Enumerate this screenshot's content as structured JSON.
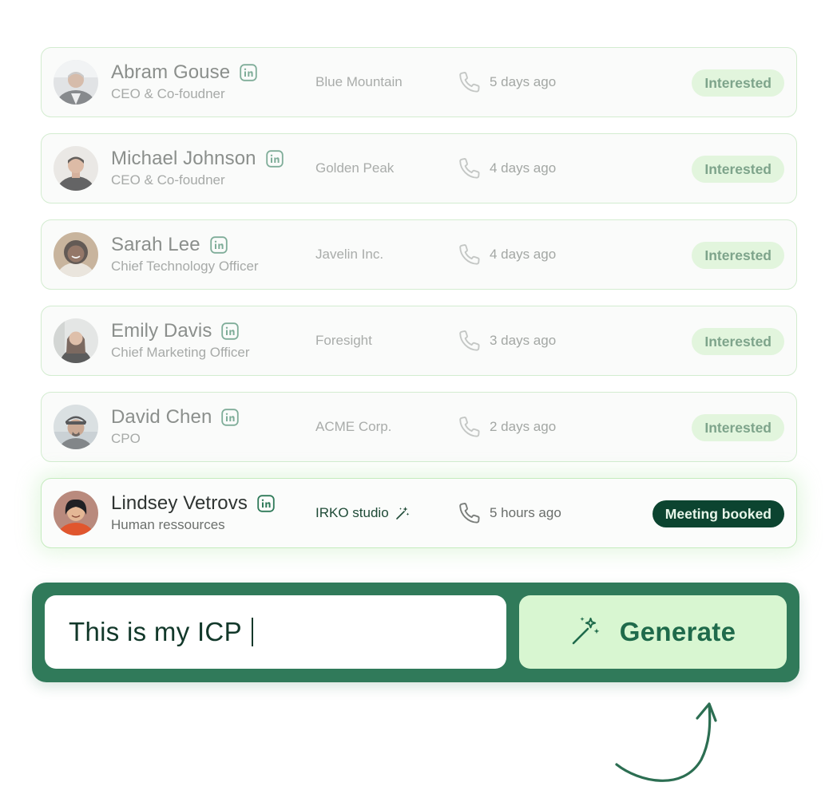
{
  "leads": [
    {
      "name": "Abram Gouse",
      "title": "CEO & Co-foudner",
      "company": "Blue Mountain",
      "last_contact": "5 days ago",
      "status": "Interested"
    },
    {
      "name": "Michael Johnson",
      "title": "CEO & Co-foudner",
      "company": "Golden Peak",
      "last_contact": "4 days ago",
      "status": "Interested"
    },
    {
      "name": "Sarah Lee",
      "title": "Chief Technology Officer",
      "company": "Javelin Inc.",
      "last_contact": "4 days ago",
      "status": "Interested"
    },
    {
      "name": "Emily Davis",
      "title": "Chief Marketing Officer",
      "company": "Foresight",
      "last_contact": "3 days ago",
      "status": "Interested"
    },
    {
      "name": "David Chen",
      "title": "CPO",
      "company": "ACME Corp.",
      "last_contact": "2 days ago",
      "status": "Interested"
    },
    {
      "name": "Lindsey Vetrovs",
      "title": "Human ressources",
      "company": "IRKO studio",
      "last_contact": "5 hours ago",
      "status": "Meeting booked"
    }
  ],
  "icons": {
    "linkedin": "linkedin-icon",
    "phone": "phone-icon",
    "magic": "magic-wand-icon",
    "arrow": "curved-arrow-icon"
  },
  "generator": {
    "input_value": "This is my ICP",
    "button_label": "Generate"
  },
  "colors": {
    "brand_green": "#307a5a",
    "booked_badge": "#0c4430",
    "interested_badge": "#e2f5dd",
    "button_bg": "#d8f6d1"
  }
}
